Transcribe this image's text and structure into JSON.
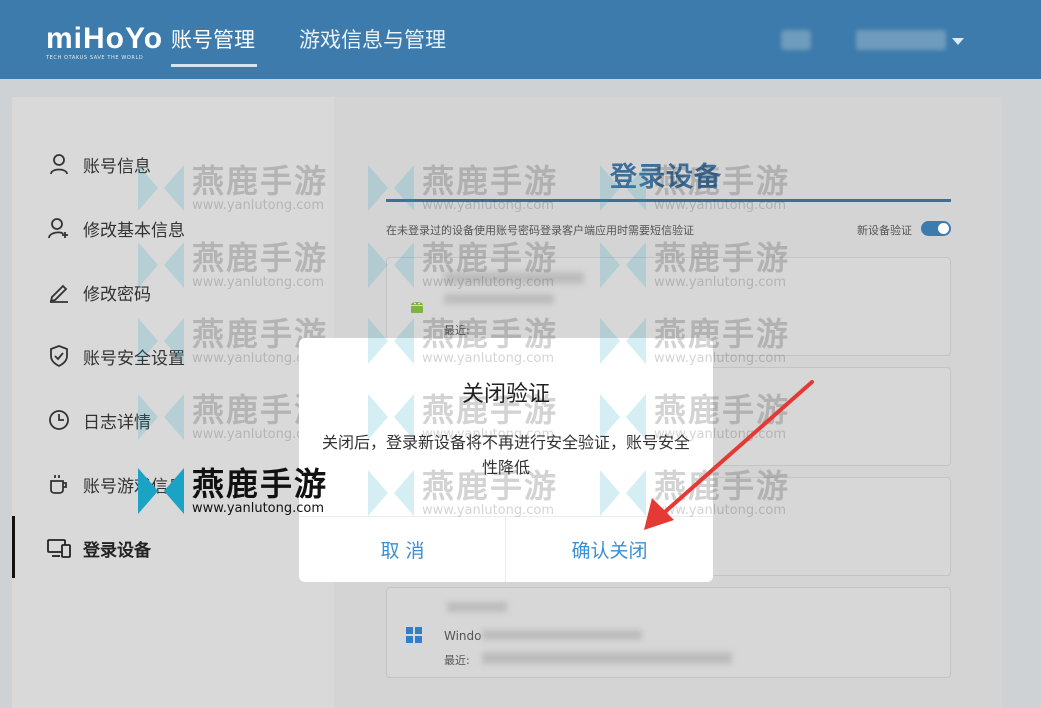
{
  "header": {
    "logo_text": "miHoYo",
    "logo_slogan": "TECH OTAKUS SAVE THE WORLD",
    "nav": [
      {
        "label": "账号管理",
        "active": true
      },
      {
        "label": "游戏信息与管理",
        "active": false
      }
    ]
  },
  "sidebar": {
    "items": [
      {
        "label": "账号信息",
        "icon": "user-icon"
      },
      {
        "label": "修改基本信息",
        "icon": "user-edit-icon"
      },
      {
        "label": "修改密码",
        "icon": "pencil-icon"
      },
      {
        "label": "账号安全设置",
        "icon": "shield-icon"
      },
      {
        "label": "日志详情",
        "icon": "clock-icon"
      },
      {
        "label": "账号游戏信息",
        "icon": "cup-icon"
      },
      {
        "label": "登录设备",
        "icon": "devices-icon",
        "active": true
      }
    ]
  },
  "content": {
    "title": "登录设备",
    "hint": "在未登录过的设备使用账号密码登录客户端应用时需要短信验证",
    "toggle_label": "新设备验证",
    "toggle_on": true,
    "devices": [
      {
        "os": "android-icon",
        "recent_label": "最近:"
      },
      {
        "os": "",
        "recent_label": ""
      },
      {
        "os": "",
        "recent_label": ""
      },
      {
        "os": "windows-icon",
        "name": "Windo",
        "recent_label": "最近:"
      }
    ]
  },
  "modal": {
    "title": "关闭验证",
    "body": "关闭后，登录新设备将不再进行安全验证，账号安全性降低",
    "cancel_label": "取 消",
    "confirm_label": "确认关闭"
  },
  "watermark": {
    "text": "燕鹿手游",
    "url": "www.yanlutong.com"
  },
  "colors": {
    "header_bg": "#3c7bab",
    "accent": "#3b8fd4",
    "title_blue": "#3f6f98",
    "arrow_red": "#e53935"
  }
}
